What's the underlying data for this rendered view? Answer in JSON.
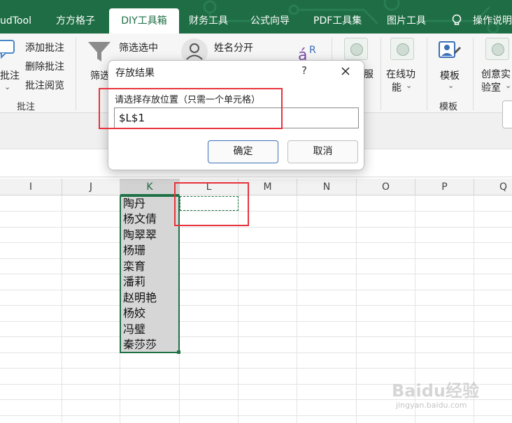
{
  "tabs": [
    "udTool",
    "方方格子",
    "DIY工具箱",
    "财务工具",
    "公式向导",
    "PDF工具集",
    "图片工具",
    "操作说明"
  ],
  "active_tab": "DIY工具箱",
  "ribbon": {
    "comment_group": {
      "add": "添加批注",
      "delete": "删除批注",
      "read": "批注阅览",
      "partial_label": "批注",
      "label": "批注"
    },
    "filter_group": {
      "filter_select": "筛选选中",
      "partial_label": "筛选"
    },
    "name_split": "姓名分开",
    "partial_label_service": "服",
    "online_func": "在线功",
    "online_func2": "能",
    "template": "模板",
    "template_group_label": "模板",
    "creative_lab1": "创意实",
    "creative_lab2": "验室"
  },
  "columns": [
    "I",
    "J",
    "K",
    "L",
    "M",
    "N",
    "O",
    "P",
    "Q"
  ],
  "selected_column": "K",
  "k_column_values": [
    "陶丹",
    "杨文倩",
    "陶翠翠",
    "杨珊",
    "栾育",
    "潘莉",
    "赵明艳",
    "杨姣",
    "冯璧",
    "秦莎莎"
  ],
  "dialog": {
    "title": "存放结果",
    "help": "?",
    "prompt": "请选择存放位置（只需一个单元格）",
    "input_value": "$L$1",
    "ok": "确定",
    "cancel": "取消"
  },
  "watermark": {
    "text": "Baidu经验",
    "sub": "jingyan.baidu.com"
  },
  "colors": {
    "accent_green": "#1e6d44",
    "highlight_red": "#e8323c",
    "ok_border": "#3b6fb6"
  }
}
